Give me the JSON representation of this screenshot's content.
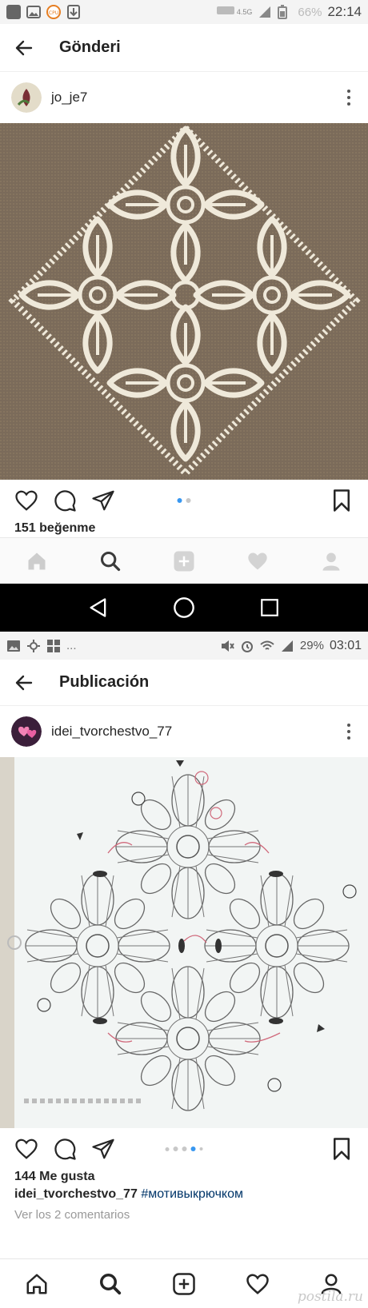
{
  "screen1": {
    "status": {
      "network": "4.5G",
      "battery": "66%",
      "time": "22:14",
      "cpu_label": "CPU"
    },
    "appbar": {
      "title": "Gönderi"
    },
    "post": {
      "username": "jo_je7",
      "likes": "151 beğenme",
      "carousel_dots": 2,
      "active_dot": 0
    }
  },
  "screen2": {
    "status": {
      "battery": "29%",
      "time": "03:01",
      "left_more": "..."
    },
    "appbar": {
      "title": "Publicación"
    },
    "post": {
      "username": "idei_tvorchestvo_77",
      "likes": "144 Me gusta",
      "caption_user": "idei_tvorchestvo_77",
      "caption_tag": "#мотивыкрючком",
      "comments_link": "Ver los 2 comentarios",
      "carousel_dots": 5,
      "active_dot": 3
    },
    "watermark": "postila.ru"
  },
  "tabs": [
    "home-icon",
    "search-icon",
    "add-icon",
    "heart-icon",
    "profile-icon"
  ],
  "colors": {
    "accent_blue": "#3897f0",
    "hashtag": "#003569",
    "fabric": "#7b6b5a",
    "yarn": "#efe9da"
  }
}
